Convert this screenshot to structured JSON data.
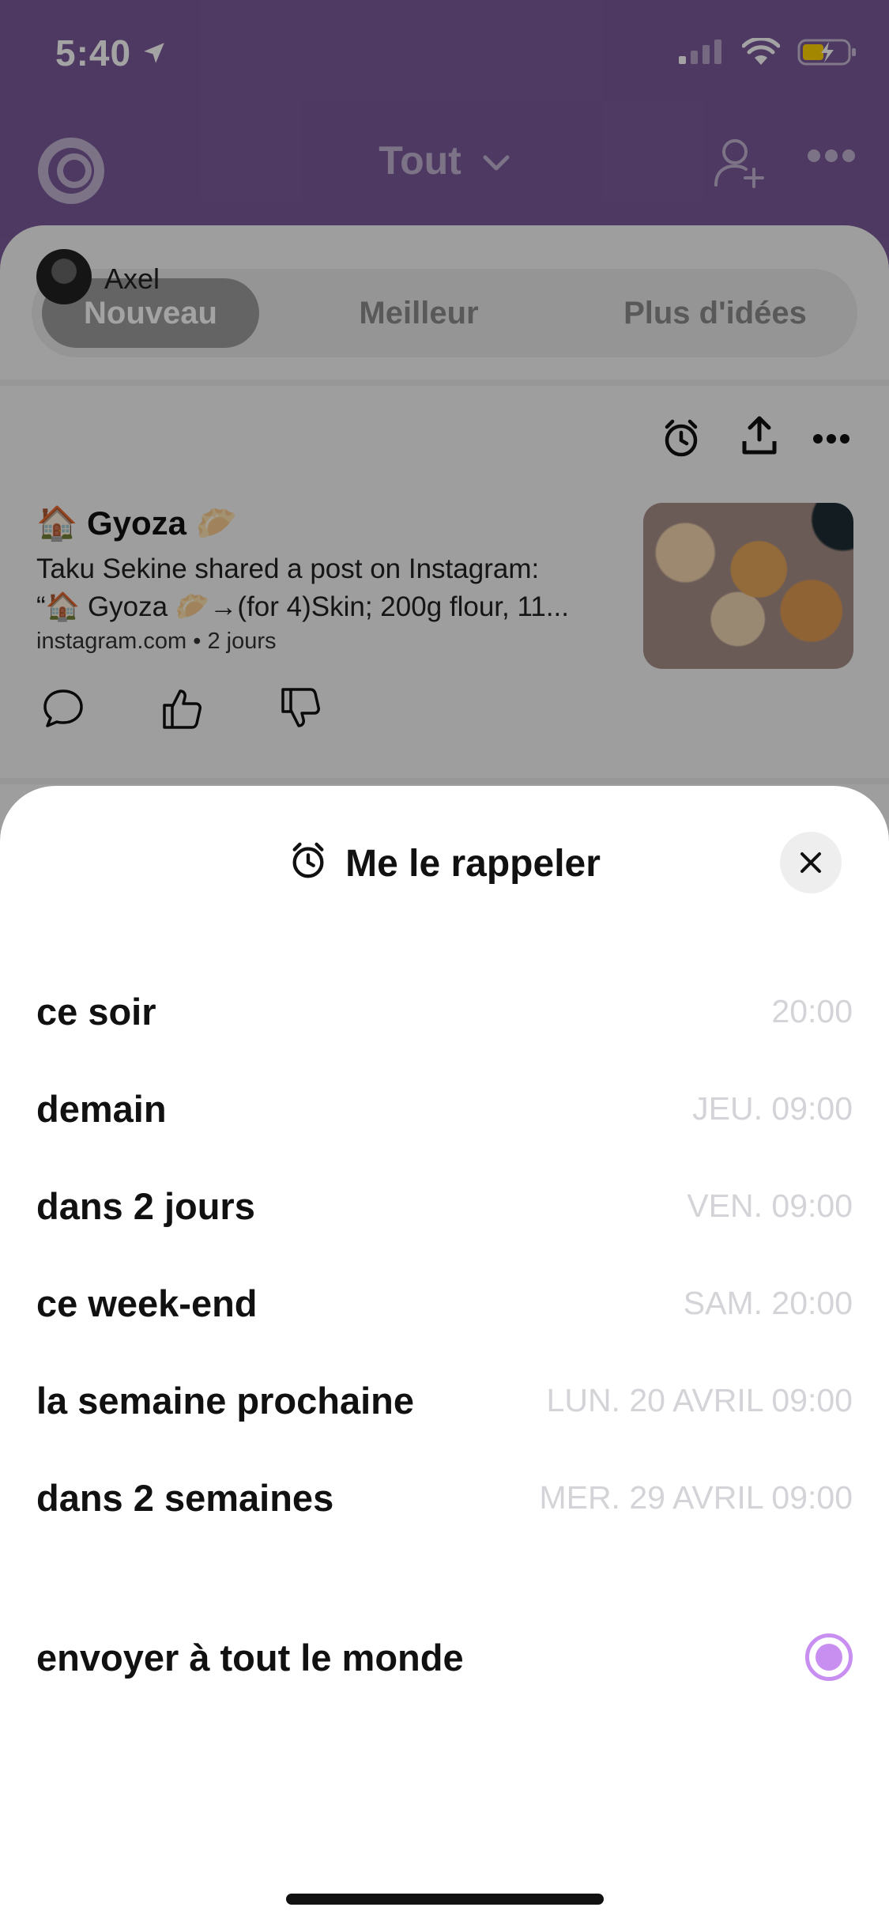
{
  "status_bar": {
    "time": "5:40"
  },
  "nav": {
    "title": "Tout"
  },
  "tabs": [
    {
      "label": "Nouveau",
      "active": true
    },
    {
      "label": "Meilleur",
      "active": false
    },
    {
      "label": "Plus d'idées",
      "active": false
    }
  ],
  "post": {
    "author": "Axel",
    "title": "🏠 Gyoza 🥟",
    "text_line1": "Taku Sekine shared a post on Instagram:",
    "text_line2": "“🏠 Gyoza 🥟→(for 4)Skin; 200g flour, 11...",
    "meta": "instagram.com • 2 jours"
  },
  "sheet": {
    "title": "Me le rappeler",
    "options": [
      {
        "label": "ce soir",
        "time": "20:00"
      },
      {
        "label": "demain",
        "time": "JEU. 09:00"
      },
      {
        "label": "dans 2 jours",
        "time": "VEN. 09:00"
      },
      {
        "label": "ce week-end",
        "time": "SAM. 20:00"
      },
      {
        "label": "la semaine prochaine",
        "time": "LUN. 20 AVRIL 09:00"
      },
      {
        "label": "dans 2 semaines",
        "time": "MER. 29 AVRIL 09:00"
      }
    ],
    "send_all": {
      "label": "envoyer à tout le monde",
      "selected": true
    }
  },
  "colors": {
    "header": "#7b5a9b",
    "radio_accent": "#c88ef0",
    "time_text": "#d4d4d8"
  }
}
